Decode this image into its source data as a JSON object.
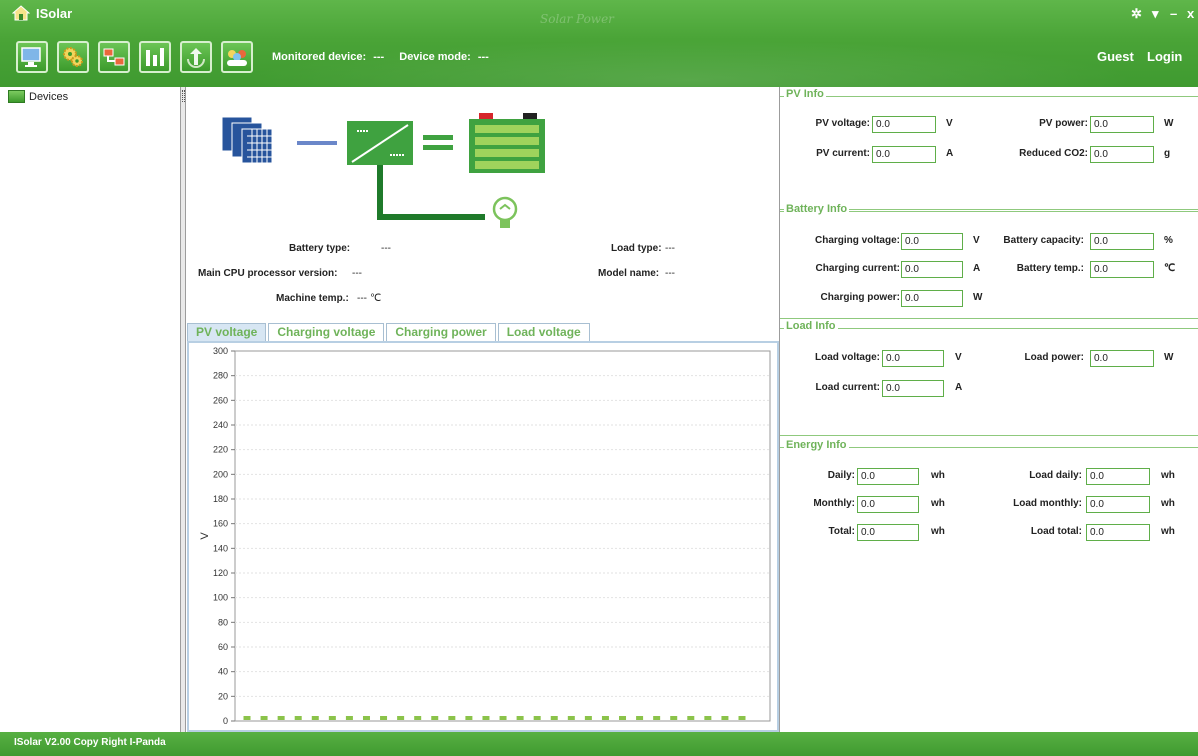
{
  "app": {
    "title": "ISolar",
    "watermark": "Solar Power"
  },
  "window_controls": [
    {
      "name": "settings",
      "glyph": "✲"
    },
    {
      "name": "pin",
      "glyph": "▾"
    },
    {
      "name": "minimize",
      "glyph": "–"
    },
    {
      "name": "close",
      "glyph": "x"
    }
  ],
  "toolbar": {
    "buttons": [
      "monitor-icon",
      "settings-gears-icon",
      "network-icon",
      "bar-chart-icon",
      "recycle-icon",
      "users-icon"
    ],
    "monitored_device_label": "Monitored device:",
    "monitored_device_value": "---",
    "device_mode_label": "Device mode:",
    "device_mode_value": "---"
  },
  "user": {
    "guest": "Guest",
    "login": "Login"
  },
  "tree": {
    "root": "Devices"
  },
  "device_info": {
    "battery_type_label": "Battery type:",
    "battery_type_value": "---",
    "load_type_label": "Load type:",
    "load_type_value": "---",
    "cpu_version_label": "Main CPU processor version:",
    "cpu_version_value": "---",
    "model_name_label": "Model name:",
    "model_name_value": "---",
    "machine_temp_label": "Machine temp.:",
    "machine_temp_value": "---",
    "machine_temp_unit": "℃"
  },
  "tabs": [
    "PV voltage",
    "Charging voltage",
    "Charging power",
    "Load voltage"
  ],
  "active_tab": 0,
  "chart_data": {
    "type": "line",
    "title": "",
    "ylabel": "V",
    "xlabel": "",
    "ylim": [
      0,
      300
    ],
    "yticks": [
      0,
      20,
      40,
      60,
      80,
      100,
      120,
      140,
      160,
      180,
      200,
      220,
      240,
      260,
      280,
      300
    ],
    "series": [
      {
        "values": [
          0,
          0,
          0,
          0,
          0,
          0,
          0,
          0,
          0,
          0,
          0,
          0,
          0,
          0,
          0,
          0,
          0,
          0,
          0,
          0,
          0,
          0,
          0,
          0,
          0,
          0,
          0,
          0,
          0,
          0
        ]
      }
    ],
    "color": "#8bc34a",
    "grid": true
  },
  "pv_info": {
    "title": "PV Info",
    "pv_voltage_label": "PV voltage:",
    "pv_voltage_value": "0.0",
    "pv_voltage_unit": "V",
    "pv_power_label": "PV power:",
    "pv_power_value": "0.0",
    "pv_power_unit": "W",
    "pv_current_label": "PV current:",
    "pv_current_value": "0.0",
    "pv_current_unit": "A",
    "co2_label": "Reduced CO2:",
    "co2_value": "0.0",
    "co2_unit": "g"
  },
  "battery_info": {
    "title": "Battery Info",
    "charging_voltage_label": "Charging voltage:",
    "charging_voltage_value": "0.0",
    "charging_voltage_unit": "V",
    "battery_capacity_label": "Battery capacity:",
    "battery_capacity_value": "0.0",
    "battery_capacity_unit": "%",
    "charging_current_label": "Charging current:",
    "charging_current_value": "0.0",
    "charging_current_unit": "A",
    "battery_temp_label": "Battery temp.:",
    "battery_temp_value": "0.0",
    "battery_temp_unit": "℃",
    "charging_power_label": "Charging power:",
    "charging_power_value": "0.0",
    "charging_power_unit": "W"
  },
  "load_info": {
    "title": "Load Info",
    "load_voltage_label": "Load voltage:",
    "load_voltage_value": "0.0",
    "load_voltage_unit": "V",
    "load_power_label": "Load power:",
    "load_power_value": "0.0",
    "load_power_unit": "W",
    "load_current_label": "Load current:",
    "load_current_value": "0.0",
    "load_current_unit": "A"
  },
  "energy_info": {
    "title": "Energy Info",
    "daily_label": "Daily:",
    "daily_value": "0.0",
    "daily_unit": "wh",
    "load_daily_label": "Load daily:",
    "load_daily_value": "0.0",
    "load_daily_unit": "wh",
    "monthly_label": "Monthly:",
    "monthly_value": "0.0",
    "monthly_unit": "wh",
    "load_monthly_label": "Load monthly:",
    "load_monthly_value": "0.0",
    "load_monthly_unit": "wh",
    "total_label": "Total:",
    "total_value": "0.0",
    "total_unit": "wh",
    "load_total_label": "Load total:",
    "load_total_value": "0.0",
    "load_total_unit": "wh"
  },
  "footer": {
    "text": "ISolar V2.00  Copy Right I-Panda"
  }
}
